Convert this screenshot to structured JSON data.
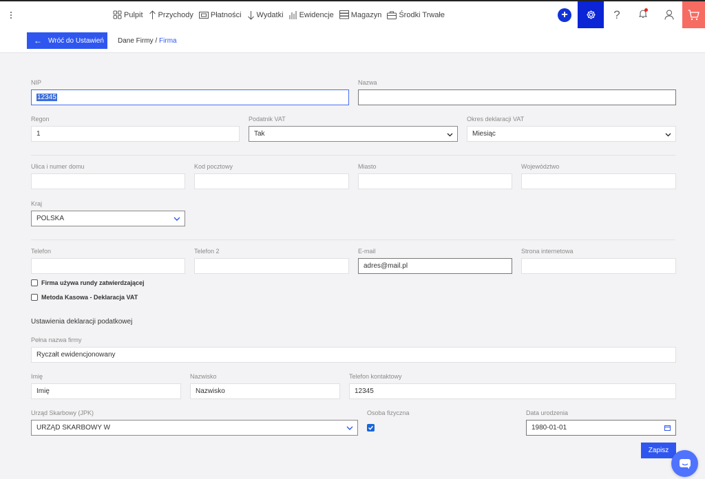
{
  "nav": {
    "items": [
      {
        "label": "Pulpit",
        "icon": "dashboard-icon"
      },
      {
        "label": "Przychody",
        "icon": "arrow-up-icon"
      },
      {
        "label": "Płatności",
        "icon": "cash-icon"
      },
      {
        "label": "Wydatki",
        "icon": "arrow-down-icon"
      },
      {
        "label": "Ewidencje",
        "icon": "bar-chart-icon"
      },
      {
        "label": "Magazyn",
        "icon": "warehouse-icon"
      },
      {
        "label": "Środki Trwałe",
        "icon": "briefcase-icon"
      }
    ],
    "plus_symbol": "+",
    "help_symbol": "?"
  },
  "subheader": {
    "back_label": "Wróć do Ustawień",
    "breadcrumb_parent": "Dane Firmy",
    "breadcrumb_sep": "/",
    "breadcrumb_current": "Firma"
  },
  "form": {
    "nip": {
      "label": "NIP",
      "value": "12345"
    },
    "nazwa": {
      "label": "Nazwa",
      "value": ""
    },
    "regon": {
      "label": "Regon",
      "value": "1"
    },
    "podatnik_vat": {
      "label": "Podatnik VAT",
      "value": "Tak"
    },
    "okres_vat": {
      "label": "Okres deklaracji VAT",
      "value": "Miesiąc"
    },
    "ulica": {
      "label": "Ulica i numer domu",
      "value": ""
    },
    "kod": {
      "label": "Kod pocztowy",
      "value": ""
    },
    "miasto": {
      "label": "Miasto",
      "value": ""
    },
    "wojewodztwo": {
      "label": "Województwo",
      "value": ""
    },
    "kraj": {
      "label": "Kraj",
      "value": "POLSKA"
    },
    "telefon": {
      "label": "Telefon",
      "value": ""
    },
    "telefon2": {
      "label": "Telefon 2",
      "value": ""
    },
    "email": {
      "label": "E-mail",
      "value": "adres@mail.pl"
    },
    "www": {
      "label": "Strona internetowa",
      "value": ""
    },
    "chk_rundy": {
      "label": "Firma używa rundy zatwierdzającej",
      "checked": false
    },
    "chk_kasowa": {
      "label": "Metoda Kasowa - Deklaracja VAT",
      "checked": false
    },
    "section_title": "Ustawienia deklaracji podatkowej",
    "pelna_nazwa": {
      "label": "Pełna nazwa firmy",
      "value": "Ryczałt ewidencjonowany"
    },
    "imie": {
      "label": "Imię",
      "value": "Imię"
    },
    "nazwisko": {
      "label": "Nazwisko",
      "value": "Nazwisko"
    },
    "telefon_kontaktowy": {
      "label": "Telefon kontaktowy",
      "value": "12345"
    },
    "urzad": {
      "label": "Urząd Skarbowy (JPK)",
      "value": "URZĄD SKARBOWY W"
    },
    "osoba_fizyczna": {
      "label": "Osoba fizyczna",
      "checked": true
    },
    "data_urodzenia": {
      "label": "Data urodzenia",
      "value": "1980-01-01"
    },
    "save_label": "Zapisz"
  },
  "colors": {
    "accent": "#2f57ef",
    "settings_active": "#0a24d6",
    "cart": "#f66b62"
  }
}
